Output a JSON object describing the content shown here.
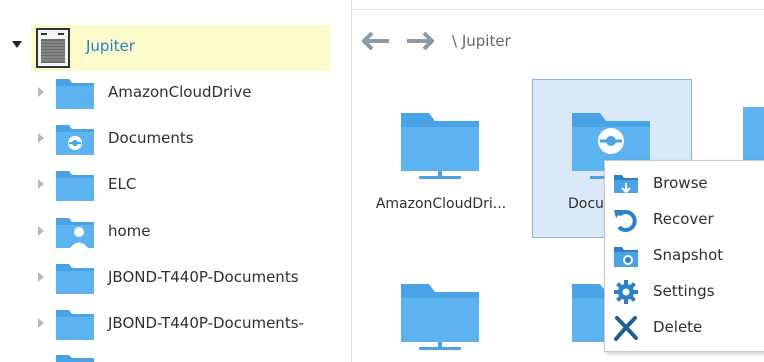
{
  "tree": {
    "root": {
      "label": "Jupiter",
      "icon": "server-icon",
      "expanded": true
    },
    "items": [
      {
        "label": "AmazonCloudDrive",
        "icon": "folder-icon"
      },
      {
        "label": "Documents",
        "icon": "sync-folder-icon"
      },
      {
        "label": "ELC",
        "icon": "folder-icon"
      },
      {
        "label": "home",
        "icon": "user-folder-icon"
      },
      {
        "label": "JBOND-T440P-Documents",
        "icon": "folder-icon"
      },
      {
        "label": "JBOND-T440P-Documents-",
        "icon": "folder-icon"
      }
    ]
  },
  "toolbar": {
    "back_icon": "arrow-left-icon",
    "forward_icon": "arrow-right-icon",
    "breadcrumb": "\\ Jupiter"
  },
  "grid": {
    "items": [
      {
        "label": "AmazonCloudDri...",
        "icon": "folder-icon",
        "selected": false
      },
      {
        "label": "Docu",
        "icon": "sync-folder-icon",
        "selected": true
      }
    ]
  },
  "context_menu": {
    "items": [
      {
        "label": "Browse",
        "icon": "browse-folder-icon"
      },
      {
        "label": "Recover",
        "icon": "recover-icon"
      },
      {
        "label": "Snapshot",
        "icon": "snapshot-icon"
      },
      {
        "label": "Settings",
        "icon": "gear-icon"
      },
      {
        "label": "Delete",
        "icon": "delete-x-icon"
      }
    ]
  },
  "colors": {
    "folder": "#4aa3e4",
    "root_highlight": "#fbfbcc",
    "selection_bg": "#dbe8f8",
    "selection_border": "#8ab4e6",
    "nav_arrow": "#8a9aa8",
    "root_label": "#2a7fc8"
  }
}
